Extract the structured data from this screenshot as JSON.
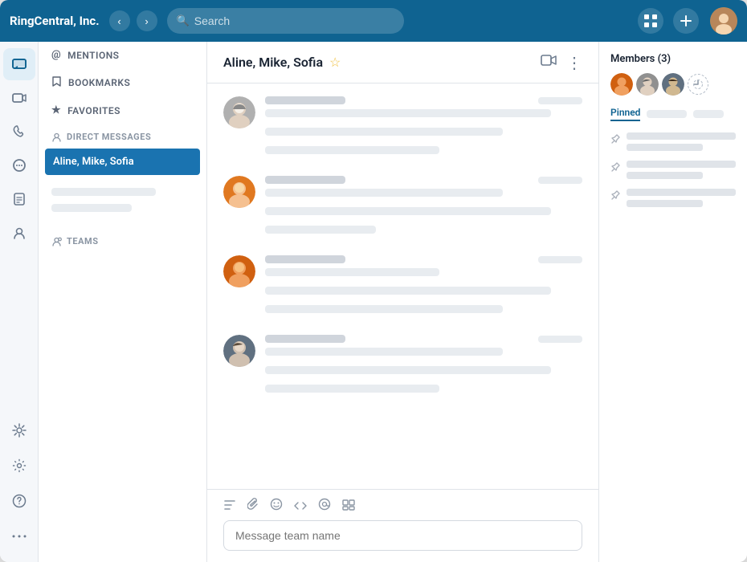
{
  "header": {
    "logo": "RingCentral, Inc.",
    "search_placeholder": "Search",
    "nav_back": "‹",
    "nav_forward": "›",
    "apps_icon": "⊞",
    "add_icon": "+"
  },
  "sidebar": {
    "sections": [
      {
        "id": "mentions",
        "label": "MENTIONS",
        "icon": "@"
      },
      {
        "id": "bookmarks",
        "label": "BOOKMARKS",
        "icon": "🔖"
      },
      {
        "id": "favorites",
        "label": "FAVORITES",
        "icon": "★"
      }
    ],
    "direct_messages_header": "DIRECT MESSAGES",
    "active_dm": "Aline, Mike, Sofia",
    "teams_header": "TEAMS"
  },
  "chat": {
    "title": "Aline, Mike, Sofia",
    "star_icon": "☆",
    "video_icon": "📹",
    "more_icon": "⋮",
    "composer_placeholder": "Message team name",
    "toolbar_icons": [
      "✏️",
      "📎",
      "😊",
      "🔲",
      "🎭",
      "📋"
    ]
  },
  "right_panel": {
    "members_label": "Members (3)",
    "pinned_label": "Pinned",
    "tab2_placeholder": "",
    "tab3_placeholder": ""
  }
}
